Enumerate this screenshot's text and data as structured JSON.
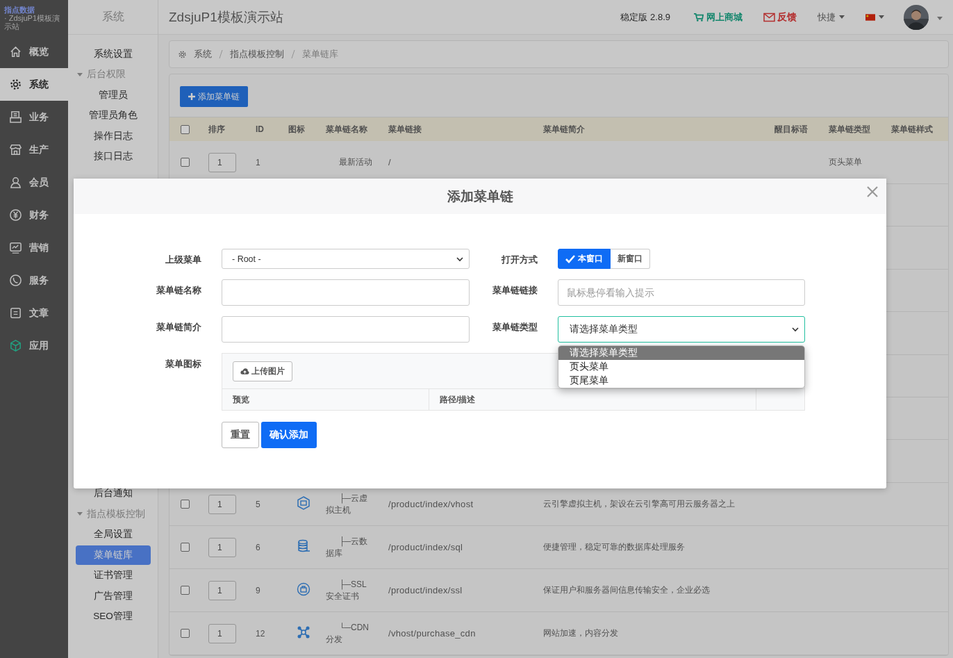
{
  "sidebar": {
    "logo": {
      "brand": "指点数据",
      "site": " · ZdsjuP1模板演示站"
    },
    "items": [
      {
        "label": "概览",
        "selected": false
      },
      {
        "label": "系统",
        "selected": true
      },
      {
        "label": "业务",
        "selected": false
      },
      {
        "label": "生产",
        "selected": false
      },
      {
        "label": "会员",
        "selected": false
      },
      {
        "label": "财务",
        "selected": false
      },
      {
        "label": "营销",
        "selected": false
      },
      {
        "label": "服务",
        "selected": false
      },
      {
        "label": "文章",
        "selected": false
      },
      {
        "label": "应用",
        "selected": false
      }
    ]
  },
  "submenu": {
    "title": "系统",
    "items": [
      {
        "label": "系统设置",
        "selected": false
      },
      {
        "label": "后台权限",
        "expanded": true,
        "children": [
          {
            "label": "管理员",
            "selected": false
          },
          {
            "label": "管理员角色",
            "selected": false
          },
          {
            "label": "操作日志",
            "selected": false
          },
          {
            "label": "接口日志",
            "selected": false
          }
        ]
      },
      {
        "label": "后台通知",
        "selected": false
      },
      {
        "label": "指点模板控制",
        "expanded": true,
        "children": [
          {
            "label": "全局设置",
            "selected": false
          },
          {
            "label": "菜单链库",
            "selected": true
          },
          {
            "label": "证书管理",
            "selected": false
          },
          {
            "label": "广告管理",
            "selected": false
          },
          {
            "label": "SEO管理",
            "selected": false
          }
        ]
      }
    ]
  },
  "topbar": {
    "title": "ZdsjuP1模板演示站",
    "version": "稳定版 2.8.9",
    "shop": "网上商城",
    "feedback": "反馈",
    "shortcuts": "快捷"
  },
  "breadcrumb": [
    "系统",
    "指点模板控制",
    "菜单链库"
  ],
  "add_button": "添加菜单链",
  "table": {
    "select_all_checked": false,
    "columns": [
      "排序",
      "ID",
      "图标",
      "菜单链名称",
      "菜单链接",
      "菜单链简介",
      "醒目标语",
      "菜单链类型",
      "菜单链样式"
    ],
    "rows": [
      {
        "checked": false,
        "sort": "1",
        "id": "1",
        "name": "最新活动",
        "link": "/",
        "intro": "",
        "type": "页头菜单"
      },
      {
        "checked": false,
        "sort": "1",
        "id": "5",
        "name": "├─云虚拟主机",
        "link": "/product/index/vhost",
        "intro": "云引擎虚拟主机，架设在云引擎高可用云服务器之上",
        "type": ""
      },
      {
        "checked": false,
        "sort": "1",
        "id": "6",
        "name": "├─云数据库",
        "link": "/product/index/sql",
        "intro": "便捷管理，稳定可靠的数据库处理服务",
        "type": ""
      },
      {
        "checked": false,
        "sort": "1",
        "id": "9",
        "name": "├─SSL安全证书",
        "link": "/product/index/ssl",
        "intro": "保证用户和服务器间信息传输安全，企业必选",
        "type": ""
      },
      {
        "checked": false,
        "sort": "1",
        "id": "12",
        "name": "└─CDN分发",
        "link": "/vhost/purchase_cdn",
        "intro": "网站加速，内容分发",
        "type": ""
      }
    ]
  },
  "dialog": {
    "title": "添加菜单链",
    "parent_label": "上级菜单",
    "parent_value": "- Root -",
    "open_label": "打开方式",
    "open_options": [
      {
        "label": "本窗口",
        "selected": true
      },
      {
        "label": "新窗口",
        "selected": false
      }
    ],
    "name_label": "菜单链名称",
    "link_label": "菜单链链接",
    "link_placeholder": "鼠标悬停看输入提示",
    "intro_label": "菜单链简介",
    "type_label": "菜单链类型",
    "type_value": "请选择菜单类型",
    "type_options": [
      {
        "label": "请选择菜单类型",
        "selected": true
      },
      {
        "label": "页头菜单",
        "selected": false
      },
      {
        "label": "页尾菜单",
        "selected": false
      }
    ],
    "icon_label": "菜单图标",
    "upload_button": "上传图片",
    "upload_columns": [
      "预览",
      "路径/描述"
    ],
    "reset_button": "重置",
    "submit_button": "确认添加"
  }
}
